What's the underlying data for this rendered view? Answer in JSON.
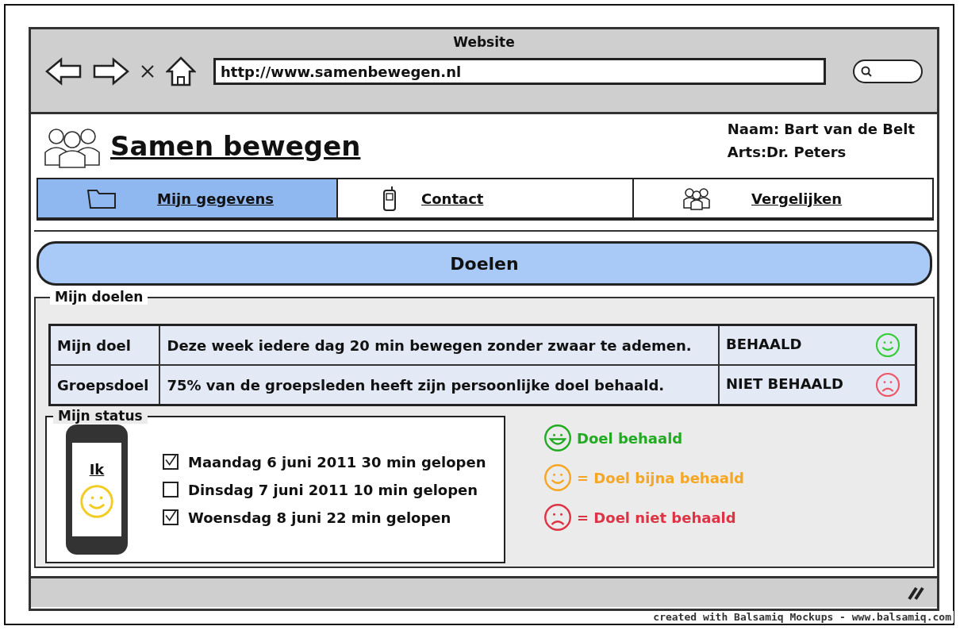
{
  "window": {
    "title": "Website",
    "url": "http://www.samenbewegen.nl"
  },
  "site": {
    "title": "Samen bewegen",
    "user_info": [
      "Naam: Bart van de Belt",
      "Arts:Dr. Peters"
    ]
  },
  "nav": [
    {
      "label": "Mijn gegevens",
      "selected": true
    },
    {
      "label": "Contact",
      "selected": false
    },
    {
      "label": "Vergelijken",
      "selected": false
    }
  ],
  "banner": "Doelen",
  "goals": {
    "legend": "Mijn doelen",
    "rows": [
      {
        "label": "Mijn doel",
        "text": "Deze week iedere dag 20 min bewegen zonder zwaar te ademen.",
        "status": "BEHAALD",
        "kind": "happy",
        "color": "#33cc33"
      },
      {
        "label": "Groepsdoel",
        "text": "75% van de groepsleden heeft zijn persoonlijke doel behaald.",
        "status": "NIET BEHAALD",
        "kind": "sad",
        "color": "#ee5566"
      }
    ]
  },
  "status": {
    "legend": "Mijn status",
    "phone_label": "Ik",
    "items": [
      {
        "text": "Maandag 6 juni 2011 30 min gelopen",
        "checked": true
      },
      {
        "text": "Dinsdag 7 juni 2011 10 min gelopen",
        "checked": false
      },
      {
        "text": "Woensdag 8 juni 22 min gelopen",
        "checked": true
      }
    ]
  },
  "legend": [
    {
      "kind": "grin",
      "text": "Doel behaald",
      "color": "#22aa22"
    },
    {
      "kind": "happy",
      "text": "= Doel bijna behaald",
      "color": "#f5a623"
    },
    {
      "kind": "sad",
      "text": "= Doel niet behaald",
      "color": "#dd3344"
    }
  ],
  "credit": "created with Balsamiq Mockups - www.balsamiq.com"
}
